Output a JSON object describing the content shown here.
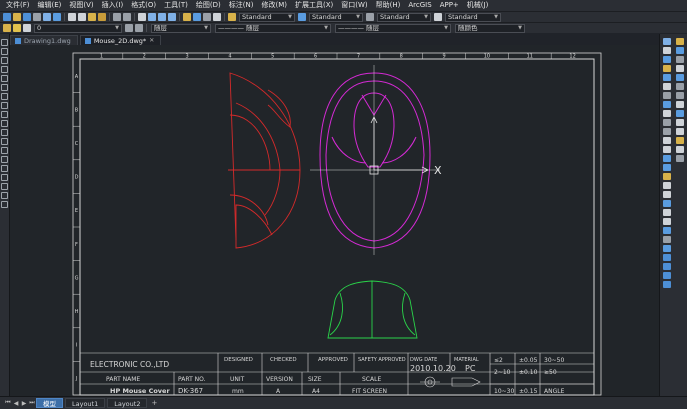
{
  "menu": {
    "items": [
      "文件(F)",
      "编辑(E)",
      "视图(V)",
      "插入(I)",
      "格式(O)",
      "工具(T)",
      "绘图(D)",
      "标注(N)",
      "修改(M)",
      "扩展工具(X)",
      "窗口(W)",
      "帮助(H)",
      "ArcGIS",
      "APP+",
      "机械(J)"
    ]
  },
  "toolbar": {
    "text_style": "Standard",
    "dim_style": "Standard",
    "table_style": "Standard",
    "multileader_style": "Standard",
    "layer": "0",
    "color": "随层",
    "linetype": "———— 随层",
    "lineweight": "———— 随层",
    "plotstyle": "随颜色"
  },
  "tabs": [
    {
      "label": "Drawing1.dwg",
      "active": false
    },
    {
      "label": "Mouse_2D.dwg*",
      "active": true
    }
  ],
  "drawing": {
    "col_numbers": [
      "1",
      "2",
      "3",
      "4",
      "5",
      "6",
      "7",
      "8",
      "9",
      "10",
      "11",
      "12"
    ],
    "row_letters": [
      "A",
      "B",
      "C",
      "D",
      "E",
      "F",
      "G",
      "H",
      "I",
      "J"
    ],
    "axis_label": "X",
    "title_block": {
      "company": "ELECTRONIC CO.,LTD",
      "designed": "DESIGNED",
      "checked": "CHECKED",
      "approved": "APPROVED",
      "safety_approved": "SAFETY APPROVED",
      "dwg_date": "DWG  DATE",
      "material": "MATERIAL",
      "date_value": "2010.10.20",
      "material_value": "PC",
      "part_name_label": "PART NAME",
      "part_no_label": "PART NO.",
      "unit_label": "UNIT",
      "version_label": "VERSION",
      "size_label": "SIZE",
      "scale_label": "SCALE",
      "part_name_value": "HP Mouse Cover",
      "part_no_value": "DK-367",
      "unit_value": "mm",
      "version_value": "A",
      "size_value": "A4",
      "scale_value": "FIT  SCREEN",
      "tolerance": [
        [
          "≤2",
          "±0.05",
          "30~50"
        ],
        [
          "2~10",
          "±0.10",
          "≥50"
        ],
        [
          "10~30",
          "±0.15",
          "ANGLE"
        ]
      ]
    }
  },
  "layout_tabs": [
    {
      "label": "模型",
      "active": true
    },
    {
      "label": "Layout1",
      "active": false
    },
    {
      "label": "Layout2",
      "active": false
    }
  ],
  "layout_add": "+",
  "colors": {
    "red_view": "#d42a2a",
    "magenta_view": "#d42ad4",
    "green_view": "#2ad44a",
    "frame": "#d8d8d8",
    "canvas": "#212529"
  }
}
